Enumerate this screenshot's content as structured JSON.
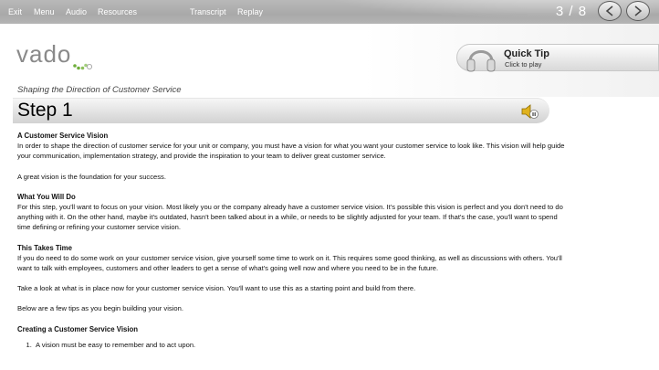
{
  "topbar": {
    "menu": [
      "Exit",
      "Menu",
      "Audio",
      "Resources",
      "Transcript",
      "Replay"
    ],
    "counter": "3 / 8",
    "prev_icon": "chevron-left-icon",
    "next_icon": "chevron-right-icon"
  },
  "brand": {
    "logo": "vado",
    "tagline": "Shaping the Direction of Customer Service"
  },
  "quick_tip": {
    "title": "Quick Tip",
    "subtitle": "Click to play",
    "icon": "headphones-icon"
  },
  "step": {
    "title": "Step 1",
    "audio_icon": "speaker-icon"
  },
  "content": {
    "sec1_heading": "A Customer Service Vision",
    "sec1_p1": "In order to shape the direction of customer service for your unit or company, you must have a vision for what you want your customer service to look like. This vision will help guide your communication, implementation strategy, and provide the inspiration to your team to deliver great customer service.",
    "sec1_p2": "A great vision is the foundation for your success.",
    "sec2_heading": "What You Will Do",
    "sec2_p1": "For this step, you'll want to focus on your vision. Most likely you or the company already have a customer service vision. It's possible this vision is perfect and you don't need to do anything with it. On the other hand, maybe it's outdated, hasn't been talked about in a while, or needs to be slightly adjusted for your team. If that's the case, you'll want to spend time defining or refining your customer service vision.",
    "sec3_heading": "This Takes Time",
    "sec3_p1": "If you do need to do some work on your customer service vision, give yourself some time to work on it. This requires some good thinking, as well as discussions with others. You'll want to talk with employees, customers and other leaders to get a sense of what's going well now and where you need to be in the future.",
    "sec3_p2": "Take a look at what is in place now for your customer service vision. You'll want to use this as a starting point and build from there.",
    "sec3_p3": "Below are a few tips as you begin building your vision.",
    "sec4_heading": "Creating a Customer Service Vision",
    "list": [
      "A vision must be easy to remember and to act upon."
    ]
  },
  "colors": {
    "topbar": "#b0b0b0",
    "accent_green": "#6fae3c"
  }
}
